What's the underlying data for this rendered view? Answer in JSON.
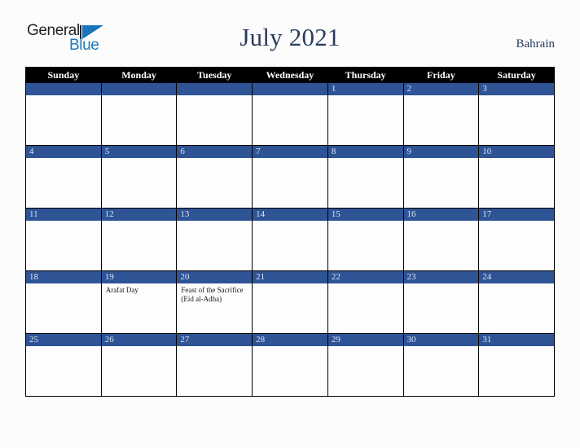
{
  "brand": {
    "logo_primary": "General",
    "logo_secondary": "Blue",
    "triangle_icon": "blue-triangle-icon"
  },
  "header": {
    "title": "July 2021",
    "country": "Bahrain"
  },
  "colors": {
    "day_bar": "#2e5496",
    "header_row": "#000000",
    "title_text": "#2a3c5e",
    "logo_blue": "#1b75bb",
    "page_background": "#fcfcfc",
    "cell_background": "#fdfdfd",
    "grid_line": "#000000"
  },
  "calendar": {
    "weekday_headers": [
      "Sunday",
      "Monday",
      "Tuesday",
      "Wednesday",
      "Thursday",
      "Friday",
      "Saturday"
    ],
    "weeks": [
      [
        {
          "day": "",
          "events": []
        },
        {
          "day": "",
          "events": []
        },
        {
          "day": "",
          "events": []
        },
        {
          "day": "",
          "events": []
        },
        {
          "day": "1",
          "events": []
        },
        {
          "day": "2",
          "events": []
        },
        {
          "day": "3",
          "events": []
        }
      ],
      [
        {
          "day": "4",
          "events": []
        },
        {
          "day": "5",
          "events": []
        },
        {
          "day": "6",
          "events": []
        },
        {
          "day": "7",
          "events": []
        },
        {
          "day": "8",
          "events": []
        },
        {
          "day": "9",
          "events": []
        },
        {
          "day": "10",
          "events": []
        }
      ],
      [
        {
          "day": "11",
          "events": []
        },
        {
          "day": "12",
          "events": []
        },
        {
          "day": "13",
          "events": []
        },
        {
          "day": "14",
          "events": []
        },
        {
          "day": "15",
          "events": []
        },
        {
          "day": "16",
          "events": []
        },
        {
          "day": "17",
          "events": []
        }
      ],
      [
        {
          "day": "18",
          "events": []
        },
        {
          "day": "19",
          "events": [
            "Arafat Day"
          ]
        },
        {
          "day": "20",
          "events": [
            "Feast of the Sacrifice (Eid al-Adha)"
          ]
        },
        {
          "day": "21",
          "events": []
        },
        {
          "day": "22",
          "events": []
        },
        {
          "day": "23",
          "events": []
        },
        {
          "day": "24",
          "events": []
        }
      ],
      [
        {
          "day": "25",
          "events": []
        },
        {
          "day": "26",
          "events": []
        },
        {
          "day": "27",
          "events": []
        },
        {
          "day": "28",
          "events": []
        },
        {
          "day": "29",
          "events": []
        },
        {
          "day": "30",
          "events": []
        },
        {
          "day": "31",
          "events": []
        }
      ]
    ]
  }
}
